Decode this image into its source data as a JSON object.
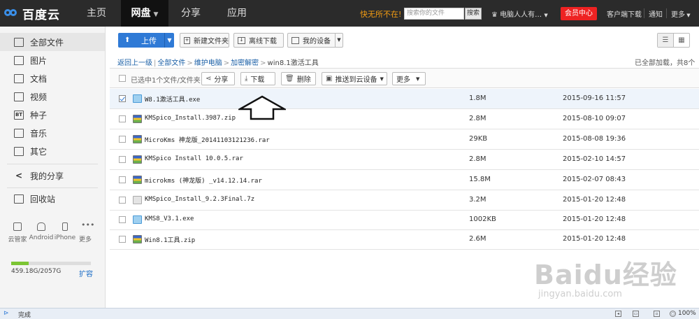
{
  "brand": {
    "logo_text": "百度云",
    "accent": "#2f7ad6"
  },
  "topnav": {
    "items": [
      "主页",
      "网盘",
      "分享",
      "应用"
    ],
    "active": "网盘",
    "promo": "快无所不在!",
    "search_placeholder": "搜索你的文件",
    "search_button": "搜索",
    "username": "电脑人人有…",
    "vip_button": "会员中心",
    "links": [
      "客户端下载",
      "通知",
      "更多"
    ]
  },
  "sidebar": {
    "items": [
      {
        "label": "全部文件",
        "icon": "all-files-icon",
        "active": true
      },
      {
        "label": "图片",
        "icon": "image-icon"
      },
      {
        "label": "文档",
        "icon": "document-icon"
      },
      {
        "label": "视频",
        "icon": "video-icon"
      },
      {
        "label": "种子",
        "icon": "bt-icon",
        "glyph": "BT"
      },
      {
        "label": "音乐",
        "icon": "music-icon"
      },
      {
        "label": "其它",
        "icon": "other-icon"
      }
    ],
    "share": "我的分享",
    "recycle": "回收站",
    "devices": [
      "云管家",
      "Android",
      "iPhone",
      "更多"
    ],
    "quota_text": "459.18G/2057G",
    "quota_fraction": 0.223,
    "expand": "扩容"
  },
  "toolbar": {
    "upload": "上传",
    "new_folder": "新建文件夹",
    "offline_download": "离线下载",
    "my_devices": "我的设备"
  },
  "breadcrumb": {
    "back": "返回上一级",
    "path": [
      "全部文件",
      "维护电脑",
      "加密解密"
    ],
    "current": "win8.1激活工具",
    "loaded": "已全部加载，共8个"
  },
  "selection": {
    "label": "已选中1个文件/文件夹",
    "buttons": {
      "share": "分享",
      "download": "下载",
      "delete": "删除",
      "push": "推送到云设备",
      "more": "更多"
    }
  },
  "files": [
    {
      "name": "W8.1激活工具.exe",
      "size": "1.8M",
      "date": "2015-09-16 11:57",
      "type": "exe",
      "selected": true
    },
    {
      "name": "KMSpico_Install.3987.zip",
      "size": "2.8M",
      "date": "2015-08-10 09:07",
      "type": "zip"
    },
    {
      "name": "MicroKms 神龙版_20141103121236.rar",
      "size": "29KB",
      "date": "2015-08-08 19:36",
      "type": "zip"
    },
    {
      "name": "KMSpico Install 10.0.5.rar",
      "size": "2.8M",
      "date": "2015-02-10 14:57",
      "type": "zip"
    },
    {
      "name": "microkms (神龙版) _v14.12.14.rar",
      "size": "15.8M",
      "date": "2015-02-07 08:43",
      "type": "zip"
    },
    {
      "name": "KMSpico_Install_9.2.3Final.7z",
      "size": "3.2M",
      "date": "2015-01-20 12:48",
      "type": "gen"
    },
    {
      "name": "KMS8_V3.1.exe",
      "size": "1002KB",
      "date": "2015-01-20 12:48",
      "type": "exe"
    },
    {
      "name": "Win8.1工具.zip",
      "size": "2.6M",
      "date": "2015-01-20 12:48",
      "type": "zip"
    }
  ],
  "status": {
    "text": "完成",
    "zoom": "100%"
  },
  "watermark": {
    "brand": "Baidu经验",
    "url": "jingyan.baidu.com"
  }
}
